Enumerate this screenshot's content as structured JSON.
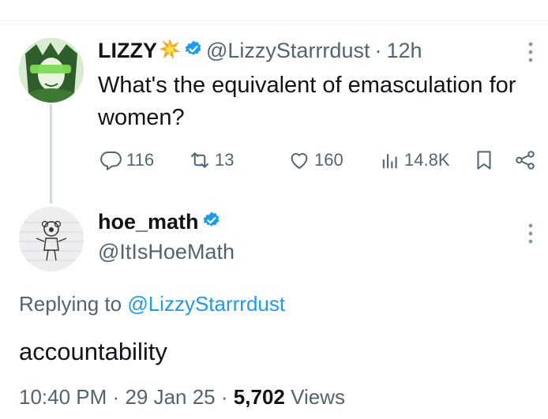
{
  "tweet": {
    "author_name": "LIZZY",
    "author_handle": "@LizzyStarrrdust",
    "separator": "·",
    "age": "12h",
    "text": "What's the equivalent of emasculation for women?",
    "replies": "116",
    "reposts": "13",
    "likes": "160",
    "views": "14.8K"
  },
  "reply": {
    "author_name": "hoe_math",
    "author_handle": "@ItIsHoeMath",
    "replying_prefix": "Replying to",
    "replying_mention": "@LizzyStarrrdust",
    "text": "accountability",
    "time": "10:40 PM",
    "date": "29 Jan 25",
    "separator": "·",
    "views_count": "5,702",
    "views_label": "Views"
  },
  "colors": {
    "accent": "#1d9bf0",
    "secondary_text": "#536471",
    "primary_text": "#0f1419",
    "verified": "#1d9bf0"
  },
  "icons": {
    "name_emoji": "collision-emoji-icon",
    "verified": "verified-badge-icon",
    "more": "more-vertical-icon",
    "reply": "reply-icon",
    "repost": "repost-icon",
    "like": "heart-icon",
    "views": "views-bar-chart-icon",
    "bookmark": "bookmark-icon",
    "share": "share-icon"
  }
}
